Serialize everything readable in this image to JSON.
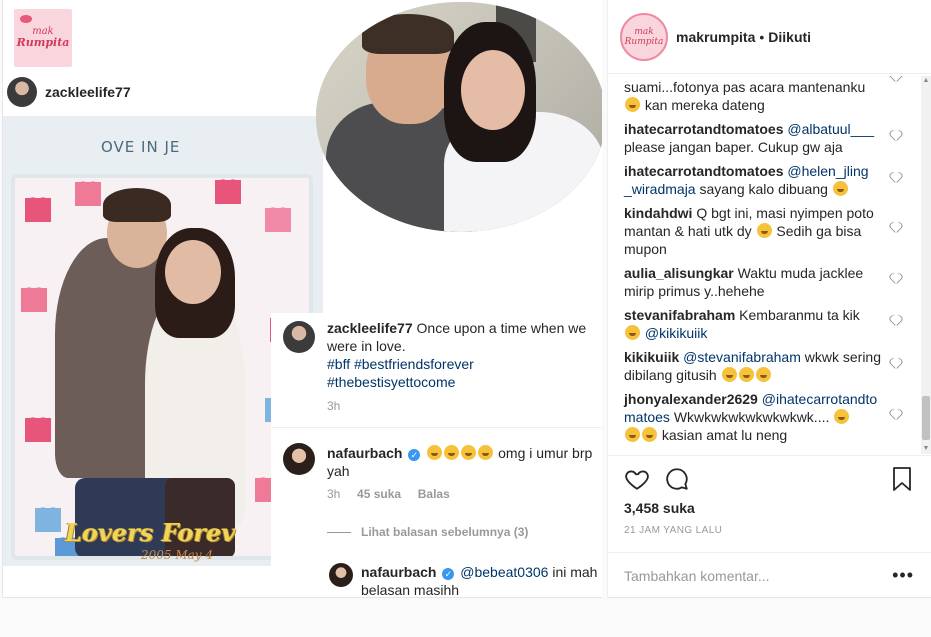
{
  "image": {
    "logo": {
      "top": "mak",
      "bottom": "Rumpita"
    },
    "source_username": "zackleelife77",
    "frame_title": "OVE IN JE",
    "frame_caption": "Lovers Forev",
    "frame_date": "2005 May 4",
    "embedded_comments": {
      "caption_user": "zackleelife77",
      "caption_text": "Once upon a time when we were in love.",
      "caption_tags_line1": "#bff #bestfriendsforever",
      "caption_tags_line2": "#thebestisyettocome",
      "caption_time": "3h",
      "reply1_user": "nafaurbach",
      "reply1_text": "omg i umur brp yah",
      "reply1_time": "3h",
      "reply1_likes": "45 suka",
      "reply1_reply": "Balas",
      "view_previous": "Lihat balasan sebelumnya (3)",
      "reply2_user": "nafaurbach",
      "reply2_mention": "@bebeat0306",
      "reply2_text": "ini mah belasan masihh"
    }
  },
  "panel": {
    "avatar_text_top": "mak",
    "avatar_text_bottom": "Rumpita",
    "username": "makrumpita",
    "separator": "•",
    "follow_status": "Diikuti",
    "comments": [
      {
        "user": "",
        "mention": "",
        "text": "suami...fotonya pas acara mantenanku",
        "text2": "kan mereka dateng"
      },
      {
        "user": "ihatecarrotandtomatoes",
        "mention": "@albatuul___",
        "text": "please jangan baper. Cukup gw aja"
      },
      {
        "user": "ihatecarrotandtomatoes",
        "mention": "@helen_jling _wiradmaja",
        "text": "sayang kalo dibuang"
      },
      {
        "user": "kindahdwi",
        "mention": "",
        "text": "Q bgt ini, masi nyimpen poto mantan & hati utk dy",
        "text2": "Sedih ga bisa mupon"
      },
      {
        "user": "aulia_alisungkar",
        "mention": "",
        "text": "Waktu muda jacklee mirip primus y..hehehe"
      },
      {
        "user": "stevanifabraham",
        "mention": "",
        "text": "Kembaranmu ta kik",
        "text2": "@kikikuiik"
      },
      {
        "user": "kikikuiik",
        "mention": "@stevanifabraham",
        "text": "wkwk sering dibilang gitusih"
      },
      {
        "user": "jhonyalexander2629",
        "mention": "@ihatecarrotandtomatoes",
        "text": "Wkwkwkwkwkwkwkwk....",
        "text2": "kasian amat lu neng"
      }
    ],
    "likes": "3,458 suka",
    "time": "21 JAM YANG LALU",
    "add_comment_placeholder": "Tambahkan komentar...",
    "more": "•••"
  }
}
